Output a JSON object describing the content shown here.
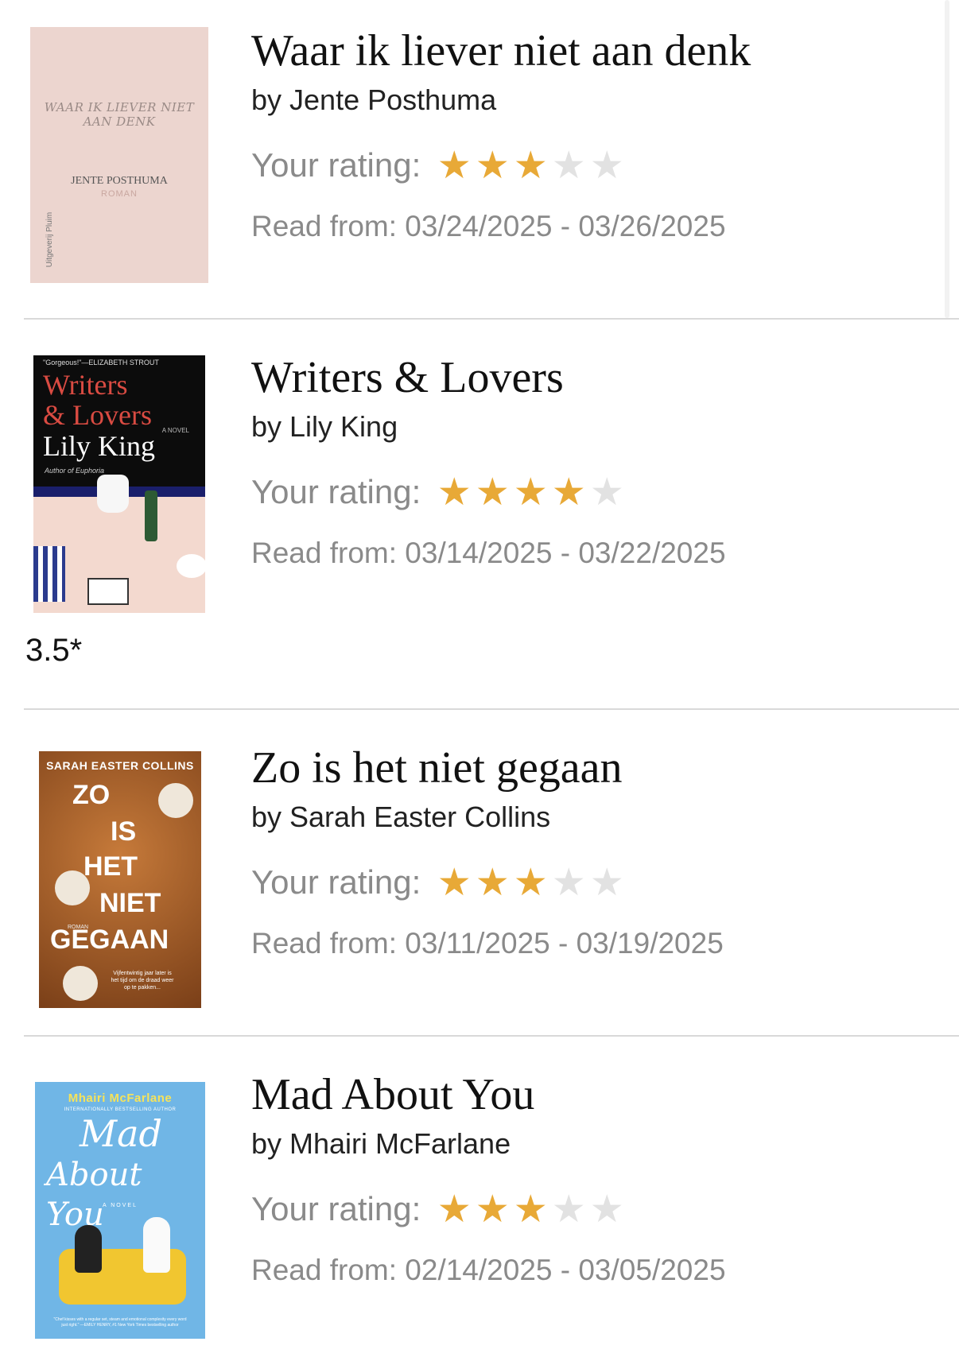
{
  "rating_label": "Your rating:",
  "colors": {
    "star_on": "#e8a937",
    "star_off": "#e2e2e2",
    "muted_text": "#8a8a8a"
  },
  "entries": [
    {
      "title": "Waar ik liever niet aan denk",
      "author": "by Jente Posthuma",
      "rating": 3,
      "max_rating": 5,
      "dates": "Read from: 03/24/2025 - 03/26/2025",
      "cover": {
        "title_text": "WAAR IK LIEVER NIET AAN DENK",
        "author_text": "JENTE POSTHUMA",
        "genre_text": "ROMAN",
        "publisher_text": "Uitgeverij Pluim"
      }
    },
    {
      "title": "Writers & Lovers",
      "author": "by Lily King",
      "rating": 4,
      "max_rating": 5,
      "dates": "Read from: 03/14/2025 - 03/22/2025",
      "note": "3.5*",
      "cover": {
        "quote_text": "\"Gorgeous!\"—ELIZABETH STROUT",
        "title_line1": "Writers",
        "title_line2": "& Lovers",
        "novel_text": "A NOVEL",
        "author_text": "Lily King",
        "author_of_text": "Author of Euphoria"
      }
    },
    {
      "title": "Zo is het niet gegaan",
      "author": "by Sarah Easter Collins",
      "rating": 3,
      "max_rating": 5,
      "dates": "Read from: 03/11/2025 - 03/19/2025",
      "cover": {
        "author_text": "SARAH EASTER COLLINS",
        "word1": "ZO",
        "word2": "IS",
        "word3": "HET",
        "word4": "NIET",
        "word5": "GEGAAN",
        "genre_text": "ROMAN",
        "blurb_text": "Vijfentwintig jaar later is het tijd om de draad weer op te pakken..."
      }
    },
    {
      "title": "Mad About You",
      "author": "by Mhairi McFarlane",
      "rating": 3,
      "max_rating": 5,
      "dates": "Read from: 02/14/2025 - 03/05/2025",
      "cover": {
        "author_text": "Mhairi McFarlane",
        "subtitle_text": "INTERNATIONALLY BESTSELLING AUTHOR",
        "title_line1": "Mad",
        "title_line2": "About You",
        "novel_text": "A NOVEL",
        "footer_text": "\"Chef kisses with a regular set, steam and emotional complexity every word just right.\" —EMILY HENRY, #1 New York Times bestselling author"
      }
    }
  ]
}
